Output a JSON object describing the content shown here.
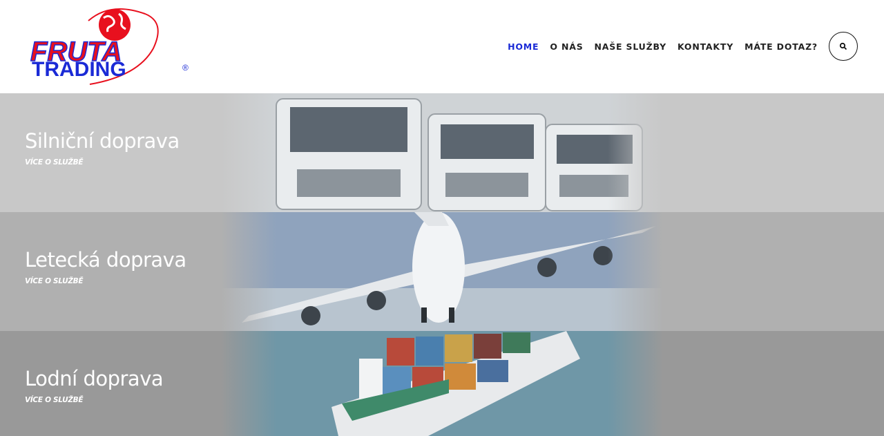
{
  "logo": {
    "line1": "FRUTA",
    "line2": "TRADING",
    "mark": "®"
  },
  "nav": {
    "items": [
      "HOME",
      "O NÁS",
      "NAŠE SLUŽBY",
      "KONTAKTY",
      "MÁTE DOTAZ?"
    ],
    "active": "HOME"
  },
  "search": {
    "icon": "search-icon"
  },
  "panels": [
    {
      "title": "Silniční doprava",
      "link": "VÍCE O SLUŽBĚ",
      "image": "trucks"
    },
    {
      "title": "Letecká doprava",
      "link": "VÍCE O SLUŽBĚ",
      "image": "airplane"
    },
    {
      "title": "Lodní doprava",
      "link": "VÍCE O SLUŽBĚ",
      "image": "container-ship"
    }
  ],
  "colors": {
    "accent": "#1a2ad6",
    "logo_red": "#e8101e",
    "logo_blue": "#1a2ad6"
  }
}
